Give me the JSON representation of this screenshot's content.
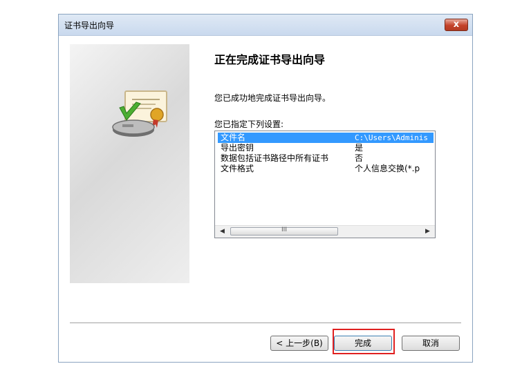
{
  "window": {
    "title": "证书导出向导",
    "close_glyph": "x"
  },
  "wizard": {
    "heading": "正在完成证书导出向导",
    "description": "您已成功地完成证书导出向导。",
    "settings_label": "您已指定下列设置:"
  },
  "settings": {
    "rows": [
      {
        "key": "文件名",
        "value": "C:\\Users\\Adminis"
      },
      {
        "key": "导出密钥",
        "value": "是"
      },
      {
        "key": "数据包括证书路径中所有证书",
        "value": "否"
      },
      {
        "key": "文件格式",
        "value": "个人信息交换(*.p"
      }
    ],
    "selected_index": 0
  },
  "scrollbar": {
    "left_glyph": "◀",
    "right_glyph": "▶",
    "grip": "III"
  },
  "buttons": {
    "back": "< 上一步(B)",
    "finish": "完成",
    "cancel": "取消"
  },
  "colors": {
    "selection": "#3399ff",
    "highlight": "#e02020"
  }
}
